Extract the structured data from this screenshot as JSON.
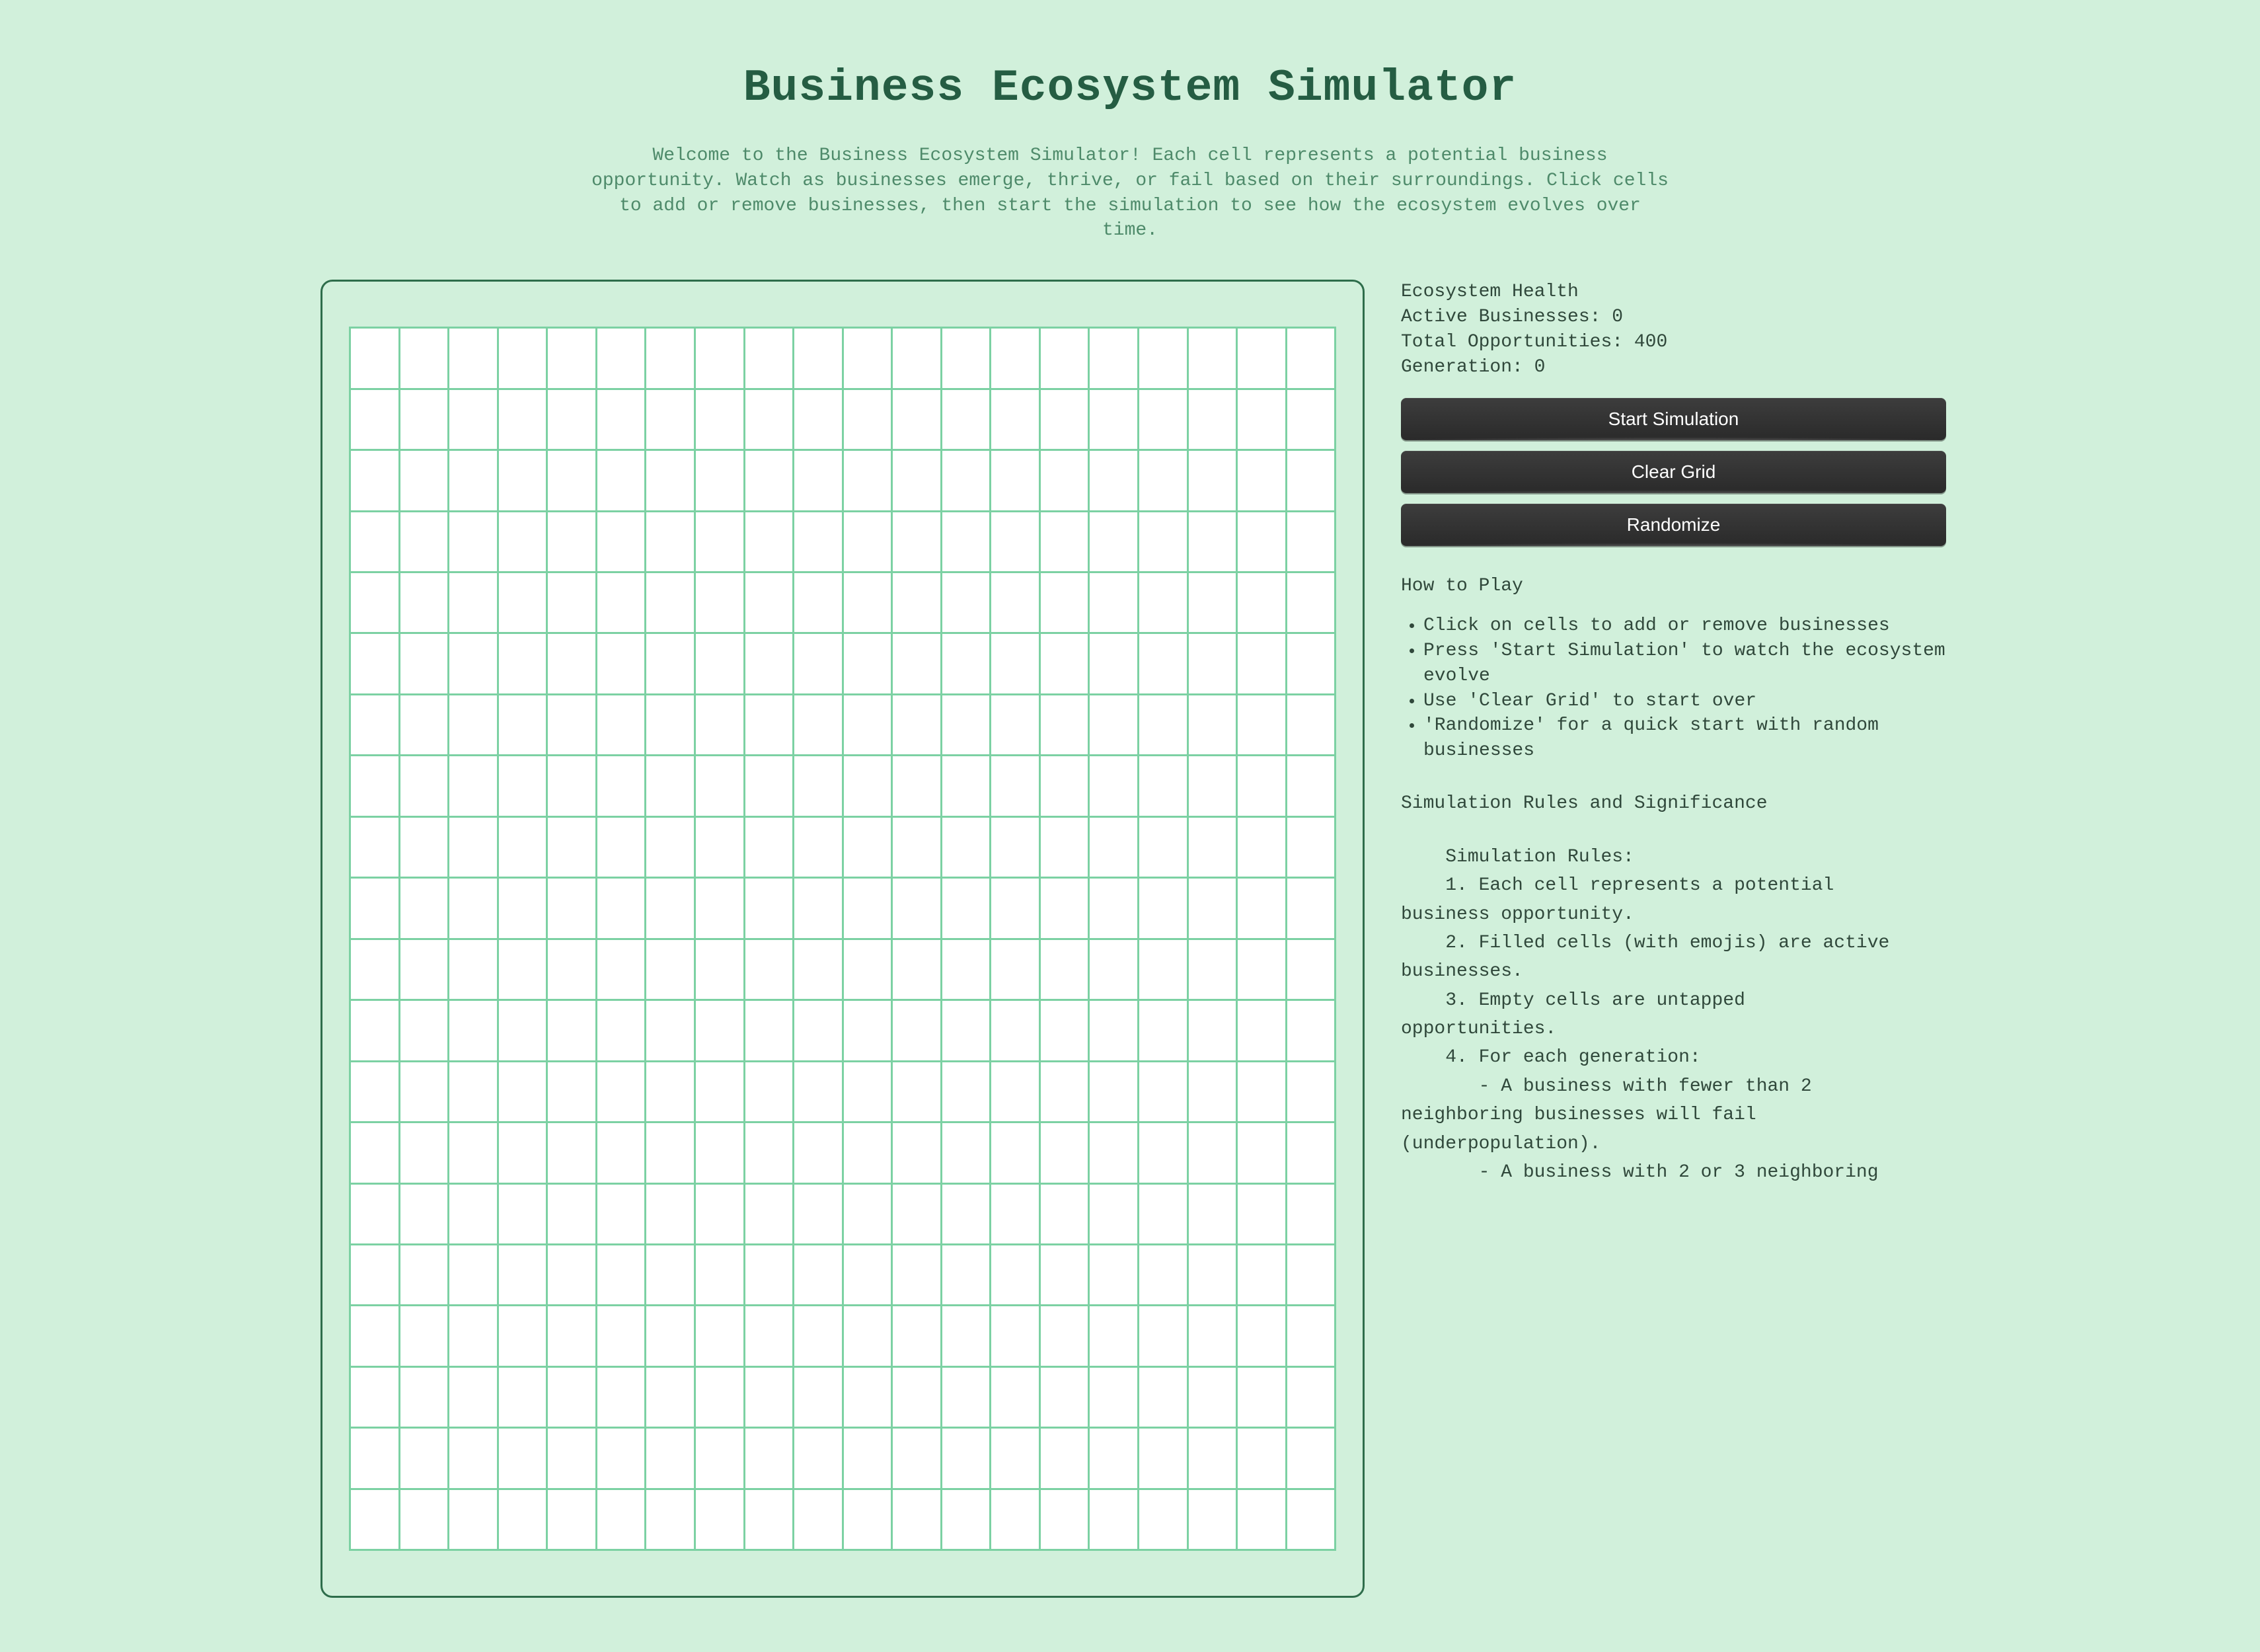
{
  "title": "Business Ecosystem Simulator",
  "intro": "Welcome to the Business Ecosystem Simulator! Each cell represents a potential business opportunity. Watch as businesses emerge, thrive, or fail based on their surroundings. Click cells to add or remove businesses, then start the simulation to see how the ecosystem evolves over time.",
  "grid": {
    "cols": 20,
    "rows": 20
  },
  "stats": {
    "heading": "Ecosystem Health",
    "active_label": "Active Businesses: ",
    "active_value": "0",
    "total_label": "Total Opportunities: ",
    "total_value": "400",
    "gen_label": "Generation: ",
    "gen_value": "0"
  },
  "buttons": {
    "start": "Start Simulation",
    "clear": "Clear Grid",
    "random": "Randomize"
  },
  "howto": {
    "title": "How to Play",
    "items": [
      "Click on cells to add or remove businesses",
      "Press 'Start Simulation' to watch the ecosystem evolve",
      "Use 'Clear Grid' to start over",
      "'Randomize' for a quick start with random businesses"
    ]
  },
  "rules": {
    "title": "Simulation Rules and Significance",
    "body": "    Simulation Rules:\n    1. Each cell represents a potential\nbusiness opportunity.\n    2. Filled cells (with emojis) are active\nbusinesses.\n    3. Empty cells are untapped\nopportunities.\n    4. For each generation:\n       - A business with fewer than 2\nneighboring businesses will fail\n(underpopulation).\n       - A business with 2 or 3 neighboring"
  }
}
